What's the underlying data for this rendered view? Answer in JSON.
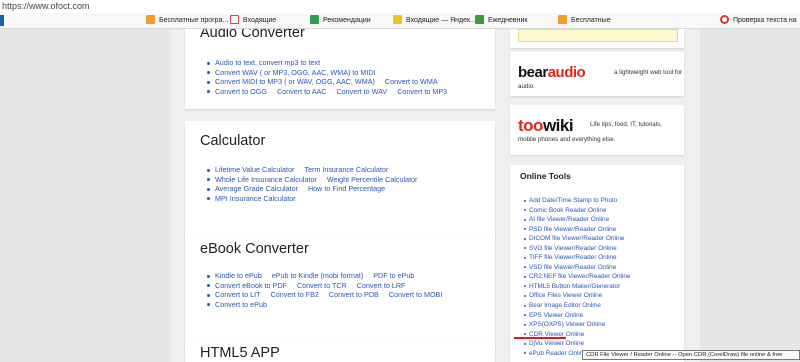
{
  "browser": {
    "url": "https://www.ofoct.com",
    "bookmarks": [
      {
        "icon": "rss-icon",
        "label": "Бесплатные програ..."
      },
      {
        "icon": "gmail-icon",
        "label": "Входящие"
      },
      {
        "icon": "youtube-icon",
        "label": "Рекомендации"
      },
      {
        "icon": "yandex-mail-icon",
        "label": "Входящие — Яндек..."
      },
      {
        "icon": "calendar-icon",
        "label": "Ежедневник"
      },
      {
        "icon": "rss-icon",
        "label": "Бесплатные"
      },
      {
        "icon": "check-icon",
        "label": "Проверка текста на"
      }
    ]
  },
  "main": {
    "audio": {
      "title": "Audio Converter",
      "rows": [
        [
          "Audio to text, convert mp3 to text"
        ],
        [
          "Convert WAV ( or MP3, OGG, AAC, WMA) to MIDI"
        ],
        [
          "Convert MIDI to MP3 ( or WAV, OGG, AAC, WMA)",
          "Convert to WMA"
        ],
        [
          "Convert to OGG",
          "Convert to AAC",
          "Convert to WAV",
          "Convert to MP3"
        ]
      ]
    },
    "calculator": {
      "title": "Calculator",
      "rows": [
        [
          "Lifetime Value Calculator",
          "Term Insurance Calculator"
        ],
        [
          "Whole Life Insurance Calculator",
          "Weight Percentile Calculator"
        ],
        [
          "Average Grade Calculator",
          "How to Find Percentage"
        ],
        [
          "MPI Insurance Calculator"
        ]
      ]
    },
    "ebook": {
      "title": "eBook Converter",
      "rows": [
        [
          "Kindle to ePub",
          "ePub to Kindle (mobi format)",
          "PDF to ePub"
        ],
        [
          "Convert eBook to PDF",
          "Convert to TCR",
          "Convert to LRF"
        ],
        [
          "Convert to LIT",
          "Convert to FB2",
          "Convert to PDB",
          "Convert to MOBI"
        ],
        [
          "Convert to ePub"
        ]
      ]
    },
    "html5": {
      "title": "HTML5 APP"
    }
  },
  "sidebar": {
    "bearaudio": {
      "logo_a": "bear",
      "logo_b": "audio",
      "tagline_1": "a lightweight web tool for",
      "tagline_2": "audio."
    },
    "toowiki": {
      "logo_a": "too",
      "logo_b": "wiki",
      "tagline_1": "Life tips, food, IT, tutorials,",
      "tagline_2": "mobile phones and everything else."
    },
    "tools": {
      "title": "Online Tools",
      "items": [
        "Add Date/Time Stamp to Photo",
        "Comic Book Reader Online",
        "AI file Viewer/Reader Online",
        "PSD file Viewer/Reader Online",
        "DICOM file Viewer/Reader Online",
        "SVG file Viewer/Reader Online",
        "TIFF file Viewer/Reader Online",
        "VSD file Viewer/Reader Online",
        "CR2,NEF file Viewer/Reader Online",
        "HTML5 Button Maker/Generator",
        "Office Files Viewer Online",
        "Bear Image Editor Online",
        "EPS Viewer Online",
        "XPS(OXPS) Viewer Online",
        "CDR Viewer Online",
        "DjVu Viewer Online",
        "ePub Reader Online"
      ]
    },
    "tooltip": "CDR File Viewer / Reader Online -- Open CDR (CorelDraw) file online & free"
  },
  "colors": {
    "link": "#2956b8",
    "bear_red": "#e0261b",
    "wiki_red": "#e0261b"
  }
}
